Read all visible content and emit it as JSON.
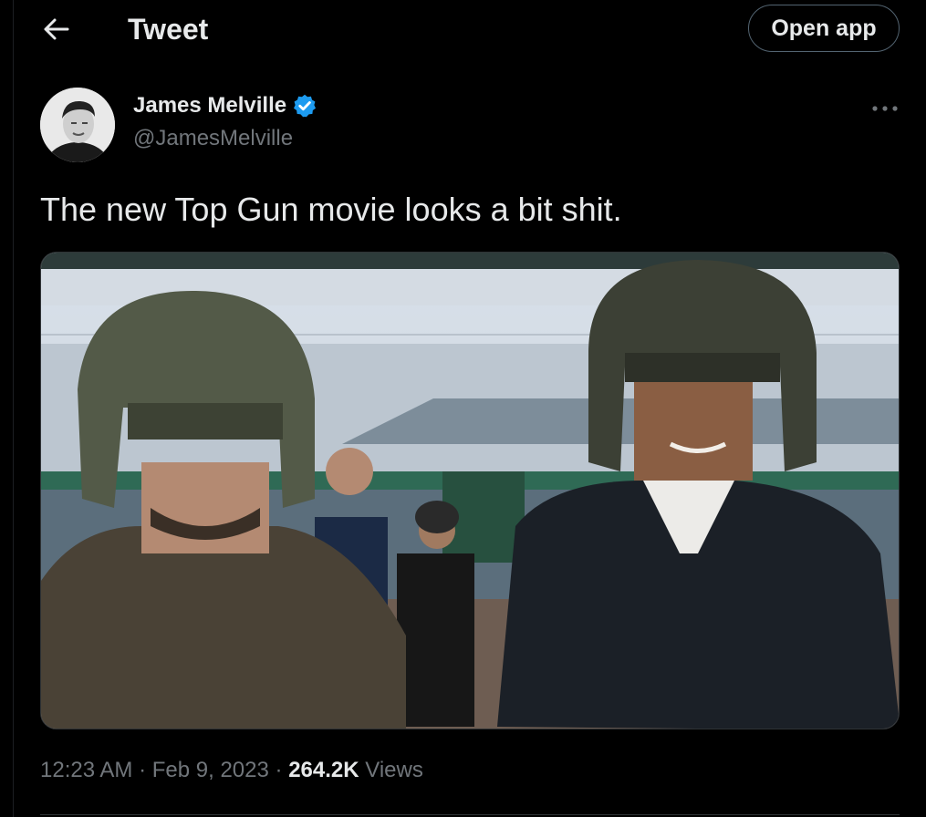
{
  "header": {
    "title": "Tweet",
    "open_app_label": "Open app",
    "back_icon": "arrow-left-icon"
  },
  "author": {
    "display_name": "James Melville",
    "handle": "@JamesMelville",
    "verified": true,
    "verified_color": "#1d9bf0"
  },
  "tweet": {
    "text": "The new Top Gun movie looks a bit shit.",
    "time": "12:23 AM",
    "date": "Feb 9, 2023",
    "separator": "·",
    "views_count": "264.2K",
    "views_label": "Views"
  },
  "colors": {
    "background": "#000000",
    "primary_text": "#e7e9ea",
    "secondary_text": "#71767b",
    "border": "#2f3336"
  }
}
